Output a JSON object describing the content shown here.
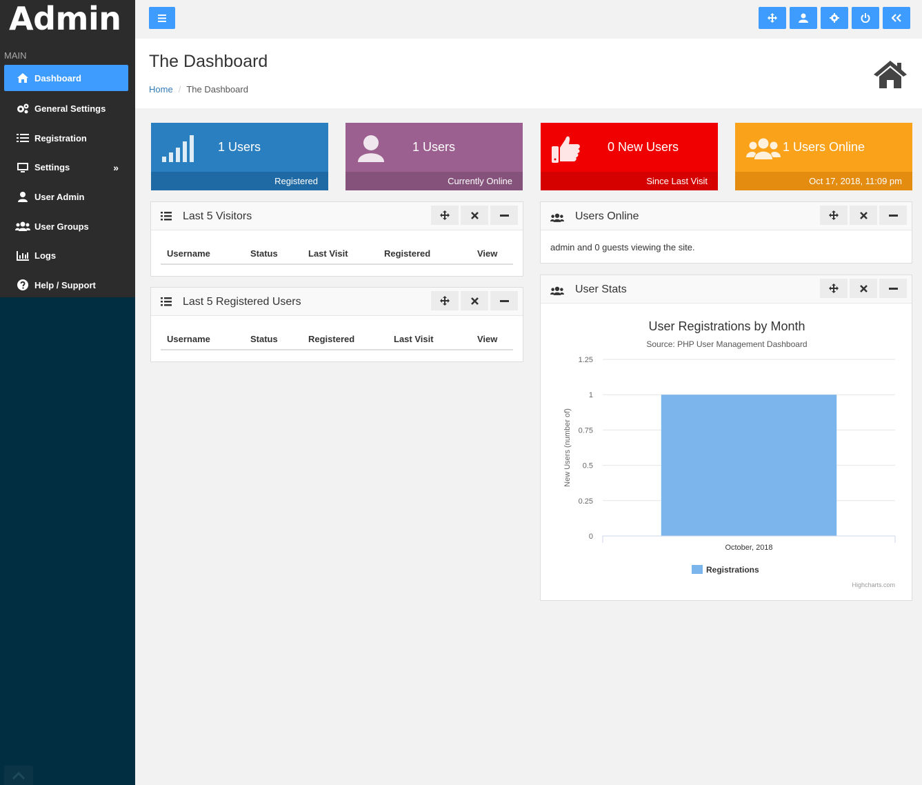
{
  "app": {
    "brand": "Admin"
  },
  "sidebar": {
    "section": "MAIN",
    "items": [
      {
        "label": "Dashboard",
        "icon": "home-icon",
        "active": true
      },
      {
        "label": "General Settings",
        "icon": "gears-icon"
      },
      {
        "label": "Registration",
        "icon": "checklist-icon"
      },
      {
        "label": "Settings",
        "icon": "monitor-icon",
        "chevron": "»"
      },
      {
        "label": "User Admin",
        "icon": "user-icon"
      },
      {
        "label": "User Groups",
        "icon": "users-icon"
      },
      {
        "label": "Logs",
        "icon": "bar-chart-icon"
      },
      {
        "label": "Help / Support",
        "icon": "question-icon"
      }
    ]
  },
  "topbar": {
    "buttons": [
      "menu-icon",
      "move-icon",
      "user-icon",
      "gear-icon",
      "power-icon",
      "double-left-icon"
    ]
  },
  "header": {
    "title": "The Dashboard",
    "breadcrumb": {
      "home": "Home",
      "separator": "/",
      "current": "The Dashboard"
    }
  },
  "tiles": [
    {
      "value": "1 Users",
      "footer": "Registered",
      "color": "#2a7fc0",
      "footer_color": "#1f6aa5",
      "icon": "signal-icon"
    },
    {
      "value": "1 Users",
      "footer": "Currently Online",
      "color": "#9b6090",
      "footer_color": "#84527b",
      "icon": "user-icon"
    },
    {
      "value": "0 New Users",
      "footer": "Since Last Visit",
      "color": "#f00000",
      "footer_color": "#d50000",
      "icon": "thumbs-up-icon"
    },
    {
      "value": "1 Users Online",
      "footer": "Oct 17, 2018, 11:09 pm",
      "color": "#faa21a",
      "footer_color": "#e38c10",
      "icon": "users-icon"
    }
  ],
  "panels": {
    "visitors": {
      "title": "Last 5 Visitors",
      "columns": [
        "Username",
        "Status",
        "Last Visit",
        "Registered",
        "View"
      ]
    },
    "registered": {
      "title": "Last 5 Registered Users",
      "columns": [
        "Username",
        "Status",
        "Registered",
        "Last Visit",
        "View"
      ]
    },
    "online": {
      "title": "Users Online",
      "text": "admin and 0 guests viewing the site."
    },
    "stats": {
      "title": "User Stats"
    }
  },
  "chart_data": {
    "type": "bar",
    "title": "User Registrations by Month",
    "subtitle": "Source: PHP User Management Dashboard",
    "categories": [
      "October, 2018"
    ],
    "series": [
      {
        "name": "Registrations",
        "values": [
          1
        ],
        "color": "#7cb5ec"
      }
    ],
    "ylabel": "New Users (number of)",
    "xlabel": "",
    "ylim": [
      0,
      1.25
    ],
    "yticks": [
      "0",
      "0.25",
      "0.5",
      "0.75",
      "1",
      "1.25"
    ],
    "grid": true,
    "legend": "bottom-center",
    "credits": "Highcharts.com"
  }
}
